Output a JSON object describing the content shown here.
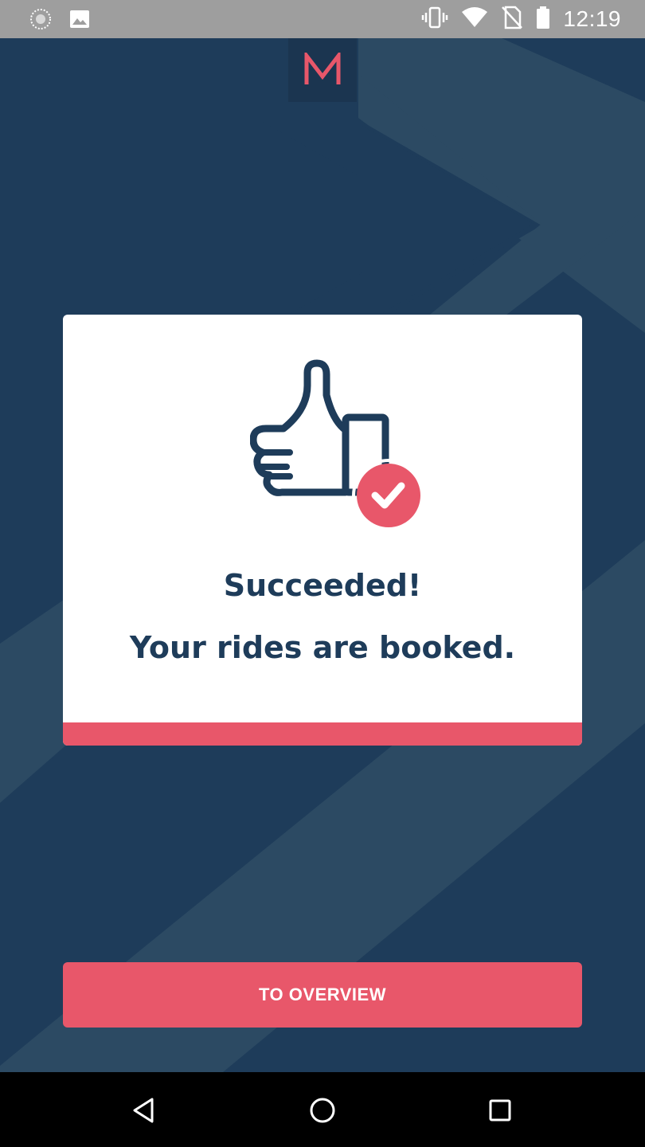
{
  "status_bar": {
    "time": "12:19",
    "icons": [
      "sync-icon",
      "image-icon",
      "vibrate-icon",
      "wifi-icon",
      "no-sim-icon",
      "battery-icon"
    ]
  },
  "app": {
    "logo_letter": "M",
    "brand_color": "#e8576a",
    "background_color": "#1e3c5a"
  },
  "card": {
    "title": "Succeeded!",
    "subtitle": "Your rides are booked.",
    "illustration": "thumbs-up-with-check-icon"
  },
  "actions": {
    "overview_label": "TO OVERVIEW"
  },
  "nav": {
    "icons": [
      "back-icon",
      "home-icon",
      "recents-icon"
    ]
  }
}
